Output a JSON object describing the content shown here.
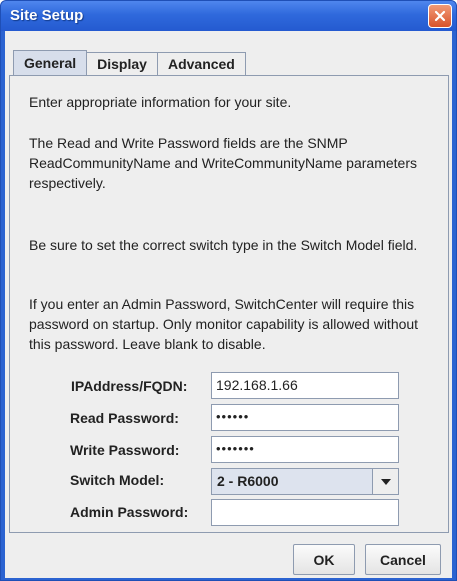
{
  "window": {
    "title": "Site Setup"
  },
  "tabs": [
    {
      "label": "General",
      "active": true
    },
    {
      "label": "Display",
      "active": false
    },
    {
      "label": "Advanced",
      "active": false
    }
  ],
  "general": {
    "paragraphs": [
      "Enter appropriate information for your site.",
      "The Read and Write Password fields are the SNMP ReadCommunityName and WriteCommunityName parameters respectively.",
      "Be sure to set the correct switch type in the Switch Model field.",
      "If you enter an Admin Password, SwitchCenter will require this password on startup. Only monitor capability is allowed without this password. Leave blank to disable."
    ],
    "form": {
      "ip": {
        "label": "IPAddress/FQDN:",
        "value": "192.168.1.66"
      },
      "read_password": {
        "label": "Read Password:",
        "value": "••••••"
      },
      "write_password": {
        "label": "Write Password:",
        "value": "•••••••"
      },
      "switch_model": {
        "label": "Switch Model:",
        "value": "2 - R6000"
      },
      "admin_password": {
        "label": "Admin Password:",
        "value": ""
      }
    }
  },
  "buttons": {
    "ok": "OK",
    "cancel": "Cancel"
  },
  "icons": {
    "close": "close-icon",
    "dropdown": "chevron-down-icon"
  },
  "colors": {
    "title_bar": "#2f69dc",
    "close_button": "#d9532a",
    "panel": "#eeeeee",
    "active_tab": "#d7deeb"
  }
}
